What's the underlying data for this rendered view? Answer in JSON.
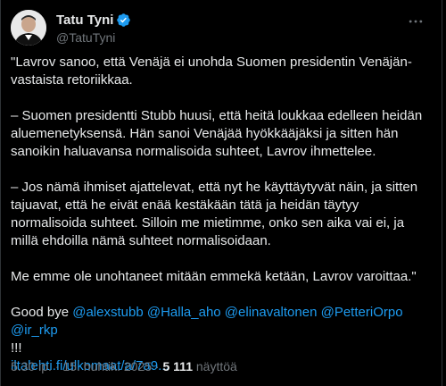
{
  "author": {
    "name": "Tatu Tyni",
    "handle": "@TatuTyni"
  },
  "tweet": {
    "paragraphs": [
      "\"Lavrov sanoo, että Venäjä ei unohda Suomen presidentin Venäjän-vastaista retoriikkaa.",
      "– Suomen presidentti Stubb huusi, että heitä loukkaa edelleen heidän aluemenetyksensä. Hän sanoi Venäjää hyökkääjäksi ja sitten hän sanoikin haluavansa normalisoida suhteet, Lavrov ihmettelee.",
      "– Jos nämä ihmiset ajattelevat, että nyt he käyttäytyvät näin, ja sitten tajuavat, että he eivät enää kestäkään tätä ja heidän täytyy normalisoida suhteet. Silloin me mietimme, onko sen aika vai ei, ja millä ehdoilla nämä suhteet normalisoidaan.",
      "Me emme ole unohtaneet mitään emmekä ketään, Lavrov varoittaa.\""
    ],
    "goodbye_text": "Good bye",
    "mentions": [
      "@alexstubb",
      "@Halla_aho",
      "@elinavaltonen",
      "@PetteriOrpo",
      "@ir_rkp"
    ],
    "exclaim": "!!!",
    "link": "iltalehti.fi/ulkomaat/a/7a9..."
  },
  "meta": {
    "time": "5.30 ip.",
    "separator": "·",
    "date": "15. huhtik. 2025",
    "views_count": "5 111",
    "views_label": "näyttöä"
  },
  "colors": {
    "background": "#000000",
    "text": "#e7e9ea",
    "secondary": "#71767b",
    "accent": "#1d9bf0"
  },
  "icons": {
    "verified": "verified-badge-icon",
    "more": "more-options-icon"
  }
}
